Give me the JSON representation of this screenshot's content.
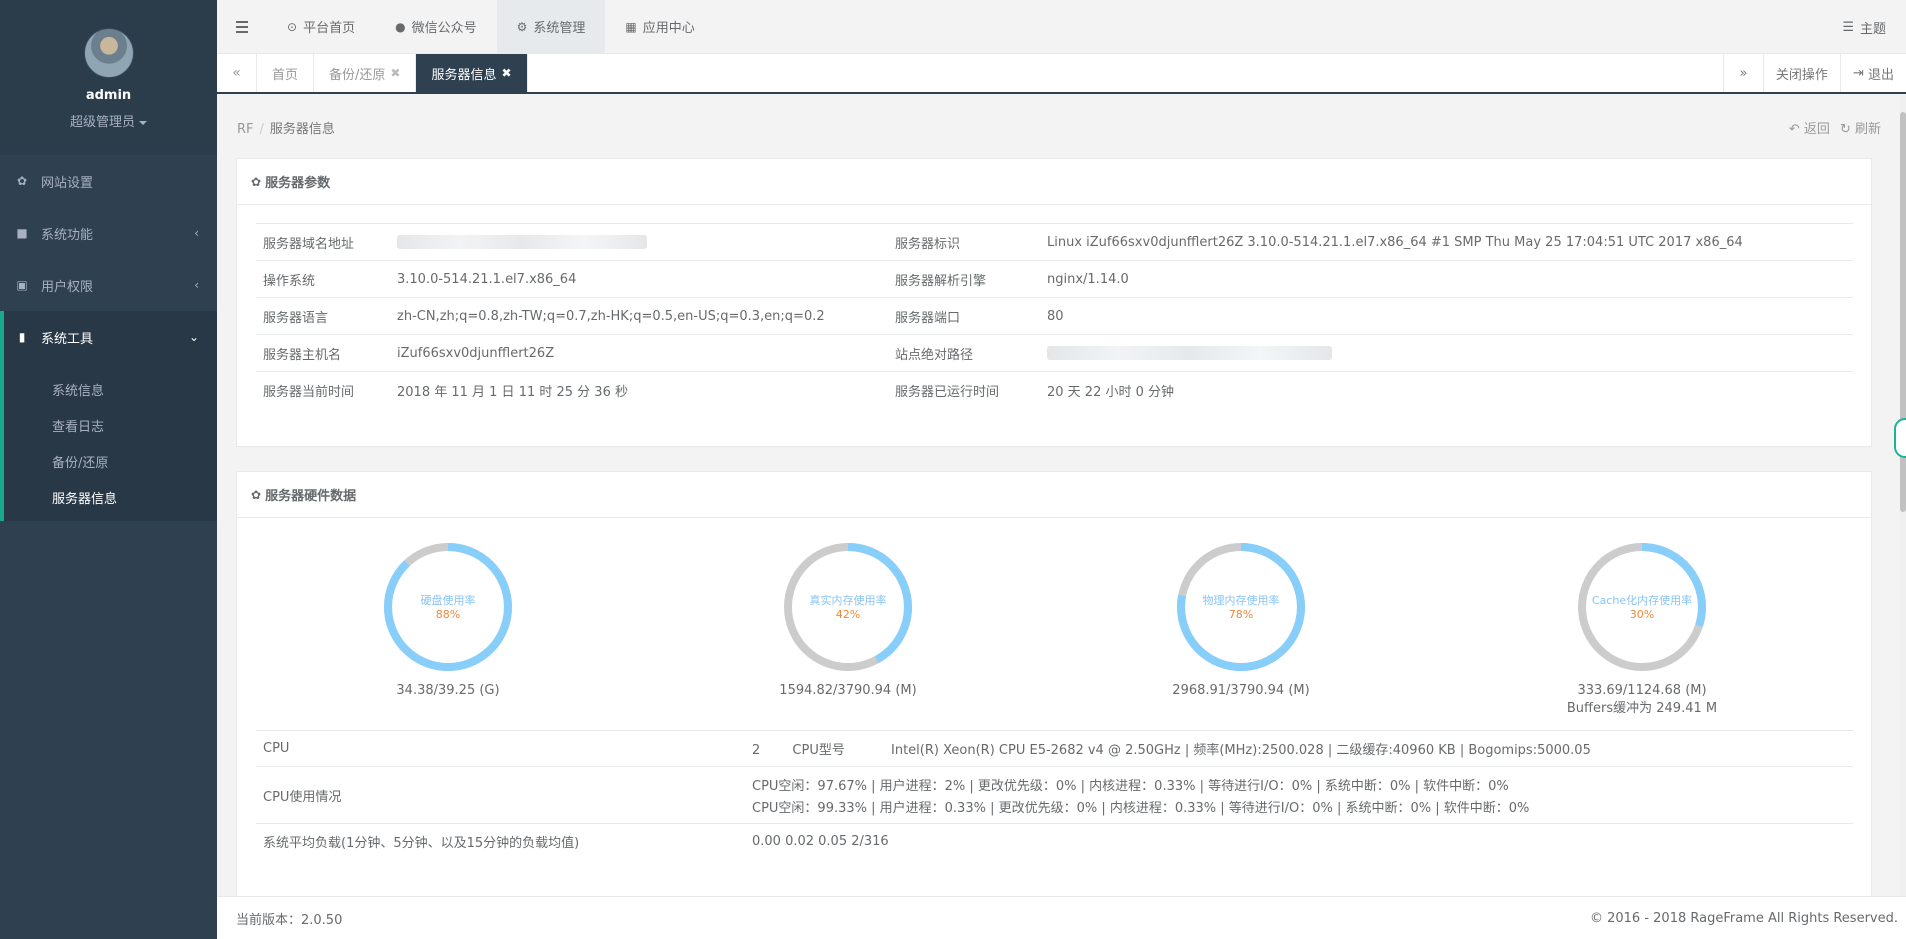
{
  "sidebar": {
    "username": "admin",
    "role": "超级管理员",
    "items": [
      {
        "label": "网站设置",
        "icon": "gear-icon"
      },
      {
        "label": "系统功能",
        "icon": "briefcase-icon"
      },
      {
        "label": "用户权限",
        "icon": "lock-icon"
      },
      {
        "label": "系统工具",
        "icon": "book-icon"
      }
    ],
    "subitems": [
      "系统信息",
      "查看日志",
      "备份/还原",
      "服务器信息"
    ]
  },
  "topnav": {
    "items": [
      "平台首页",
      "微信公众号",
      "系统管理",
      "应用中心"
    ],
    "theme": "主题"
  },
  "tabs": {
    "items": [
      "首页",
      "备份/还原",
      "服务器信息"
    ],
    "close_ops": "关闭操作",
    "logout": "退出"
  },
  "breadcrumb": {
    "root": "RF",
    "current": "服务器信息",
    "back": "返回",
    "refresh": "刷新"
  },
  "params_panel": {
    "title": "服务器参数",
    "rows": [
      {
        "k1": "服务器域名地址",
        "v1": "",
        "k2": "服务器标识",
        "v2": "Linux iZuf66sxv0djunfflert26Z 3.10.0-514.21.1.el7.x86_64 #1 SMP Thu May 25 17:04:51 UTC 2017 x86_64"
      },
      {
        "k1": "操作系统",
        "v1": "3.10.0-514.21.1.el7.x86_64",
        "k2": "服务器解析引擎",
        "v2": "nginx/1.14.0"
      },
      {
        "k1": "服务器语言",
        "v1": "zh-CN,zh;q=0.8,zh-TW;q=0.7,zh-HK;q=0.5,en-US;q=0.3,en;q=0.2",
        "k2": "服务器端口",
        "v2": "80"
      },
      {
        "k1": "服务器主机名",
        "v1": "iZuf66sxv0djunfflert26Z",
        "k2": "站点绝对路径",
        "v2": ""
      },
      {
        "k1": "服务器当前时间",
        "v1": "2018 年 11 月 1 日 11 时 25 分 36 秒",
        "k2": "服务器已运行时间",
        "v2": "20 天 22 小时 0 分钟"
      }
    ]
  },
  "hardware_panel": {
    "title": "服务器硬件数据",
    "gauges": [
      {
        "label": "硬盘使用率",
        "percent": 88,
        "pct_text": "88%",
        "caption": "34.38/39.25 (G)",
        "caption2": ""
      },
      {
        "label": "真实内存使用率",
        "percent": 42,
        "pct_text": "42%",
        "caption": "1594.82/3790.94 (M)",
        "caption2": ""
      },
      {
        "label": "物理内存使用率",
        "percent": 78,
        "pct_text": "78%",
        "caption": "2968.91/3790.94 (M)",
        "caption2": ""
      },
      {
        "label": "Cache化内存使用率",
        "percent": 30,
        "pct_text": "30%",
        "caption": "333.69/1124.68 (M)",
        "caption2": "Buffers缓冲为 249.41 M"
      }
    ],
    "colors": {
      "used": "#87cefa",
      "free": "#cccccc",
      "pct": "#f0883e"
    },
    "cpu_label": "CPU",
    "cpu_count": "2",
    "cpu_model_label": "CPU型号",
    "cpu_model": "Intel(R) Xeon(R) CPU E5-2682 v4 @ 2.50GHz | 频率(MHz):2500.028 | 二级缓存:40960 KB | Bogomips:5000.05",
    "cpu_usage_label": "CPU使用情况",
    "cpu_usage_1": "CPU空闲：97.67% | 用户进程：2% | 更改优先级：0% | 内核进程：0.33% | 等待进行I/O：0% | 系统中断：0% | 软件中断：0%",
    "cpu_usage_2": "CPU空闲：99.33% | 用户进程：0.33% | 更改优先级：0% | 内核进程：0.33% | 等待进行I/O：0% | 系统中断：0% | 软件中断：0%",
    "load_label": "系统平均负载(1分钟、5分钟、以及15分钟的负载均值)",
    "load_value": "0.00 0.02 0.05 2/316"
  },
  "footer": {
    "version": "当前版本：2.0.50",
    "copyright": "© 2016 - 2018 RageFrame All Rights Reserved."
  }
}
